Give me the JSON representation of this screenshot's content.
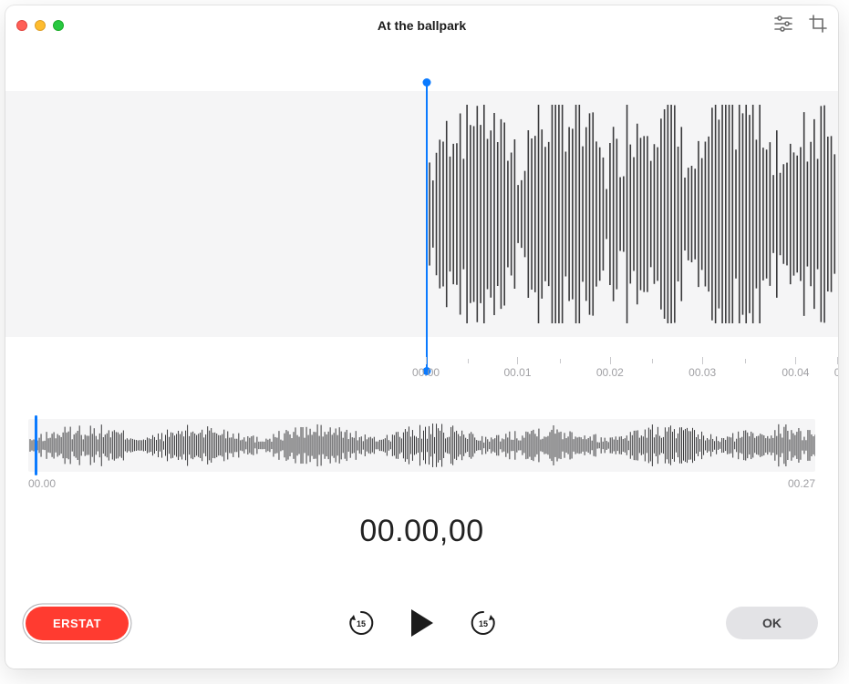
{
  "header": {
    "title": "At the ballpark"
  },
  "main_wave": {
    "playhead_position_pct": 50.5,
    "ticks": [
      {
        "pct": 50.5,
        "label": "00.00",
        "major": true
      },
      {
        "pct": 55.5,
        "label": "",
        "major": false
      },
      {
        "pct": 61.5,
        "label": "00.01",
        "major": true
      },
      {
        "pct": 66.6,
        "label": "",
        "major": false
      },
      {
        "pct": 72.6,
        "label": "00.02",
        "major": true
      },
      {
        "pct": 77.7,
        "label": "",
        "major": false
      },
      {
        "pct": 83.7,
        "label": "00.03",
        "major": true
      },
      {
        "pct": 88.8,
        "label": "",
        "major": false
      },
      {
        "pct": 94.9,
        "label": "00.04",
        "major": true
      },
      {
        "pct": 99.9,
        "label": "0",
        "major": true
      }
    ]
  },
  "overview": {
    "playhead_position_pct": 0.8,
    "start_label": "00.00",
    "end_label": "00.27"
  },
  "current_time": "00.00,00",
  "controls": {
    "record_label": "ERSTAT",
    "skip_back_seconds": "15",
    "skip_fwd_seconds": "15",
    "done_label": "OK"
  },
  "colors": {
    "accent": "#0a7aff",
    "record": "#ff3b30"
  }
}
